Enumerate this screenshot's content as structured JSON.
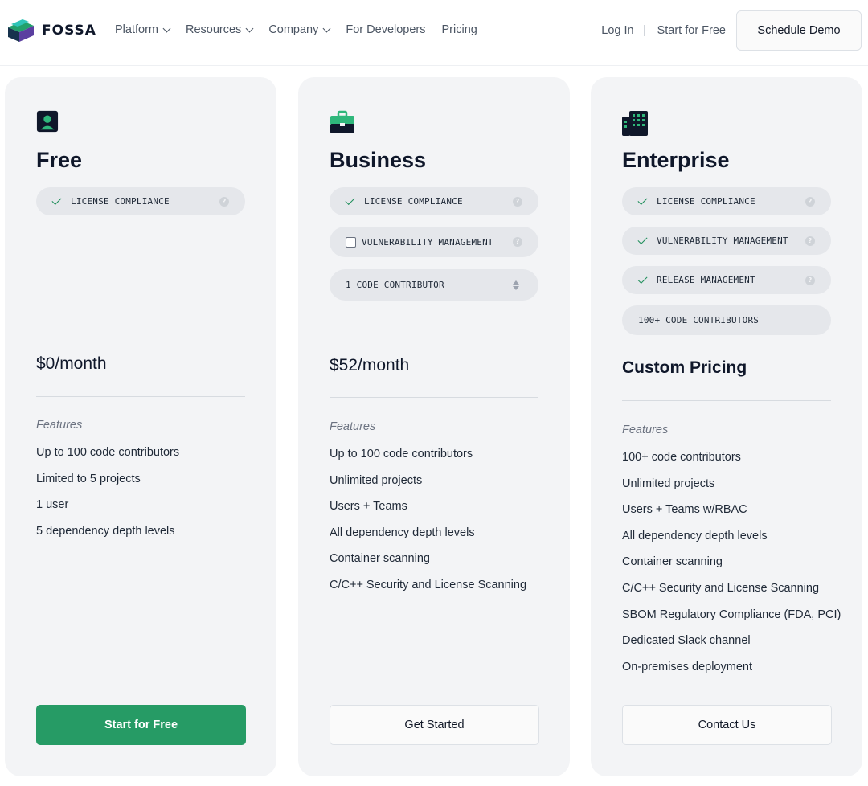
{
  "nav": {
    "brand": "FOSSA",
    "menu": [
      {
        "label": "Platform",
        "has_dropdown": true
      },
      {
        "label": "Resources",
        "has_dropdown": true
      },
      {
        "label": "Company",
        "has_dropdown": true
      },
      {
        "label": "For Developers",
        "has_dropdown": false
      },
      {
        "label": "Pricing",
        "has_dropdown": false
      }
    ],
    "login": "Log In",
    "start_free": "Start for Free",
    "schedule_demo": "Schedule Demo"
  },
  "colors": {
    "accent_green": "#269b65",
    "card_bg": "#f3f4f6",
    "pill_bg": "#e5e7eb",
    "text_dark": "#0f172a"
  },
  "plans": [
    {
      "name": "Free",
      "icon": "user-badge-icon",
      "options": [
        {
          "label": "LICENSE COMPLIANCE",
          "state": "checked",
          "help": "?"
        }
      ],
      "price": "$0/month",
      "features_label": "Features",
      "features": [
        "Up to 100 code contributors",
        "Limited to 5 projects",
        "1 user",
        "5 dependency depth levels"
      ],
      "cta": "Start for Free"
    },
    {
      "name": "Business",
      "icon": "briefcase-icon",
      "options": [
        {
          "label": "LICENSE COMPLIANCE",
          "state": "checked",
          "help": "?"
        },
        {
          "label": "VULNERABILITY MANAGEMENT",
          "state": "unchecked",
          "help": "?"
        },
        {
          "label": "1 CODE CONTRIBUTOR",
          "state": "stepper"
        }
      ],
      "price": "$52/month",
      "features_label": "Features",
      "features": [
        "Up to 100 code contributors",
        "Unlimited projects",
        "Users + Teams",
        "All dependency depth levels",
        "Container scanning",
        "C/C++ Security and License Scanning"
      ],
      "cta": "Get Started"
    },
    {
      "name": "Enterprise",
      "icon": "building-icon",
      "options": [
        {
          "label": "LICENSE COMPLIANCE",
          "state": "checked",
          "help": "?"
        },
        {
          "label": "VULNERABILITY MANAGEMENT",
          "state": "checked",
          "help": "?"
        },
        {
          "label": "RELEASE MANAGEMENT",
          "state": "checked",
          "help": "?"
        },
        {
          "label": "100+ CODE CONTRIBUTORS",
          "state": "static"
        }
      ],
      "price": "Custom Pricing",
      "features_label": "Features",
      "features": [
        "100+ code contributors",
        "Unlimited projects",
        "Users + Teams w/RBAC",
        "All dependency depth levels",
        "Container scanning",
        "C/C++ Security and License Scanning",
        "SBOM Regulatory Compliance (FDA, PCI)",
        "Dedicated Slack channel",
        "On-premises deployment"
      ],
      "cta": "Contact Us"
    }
  ]
}
